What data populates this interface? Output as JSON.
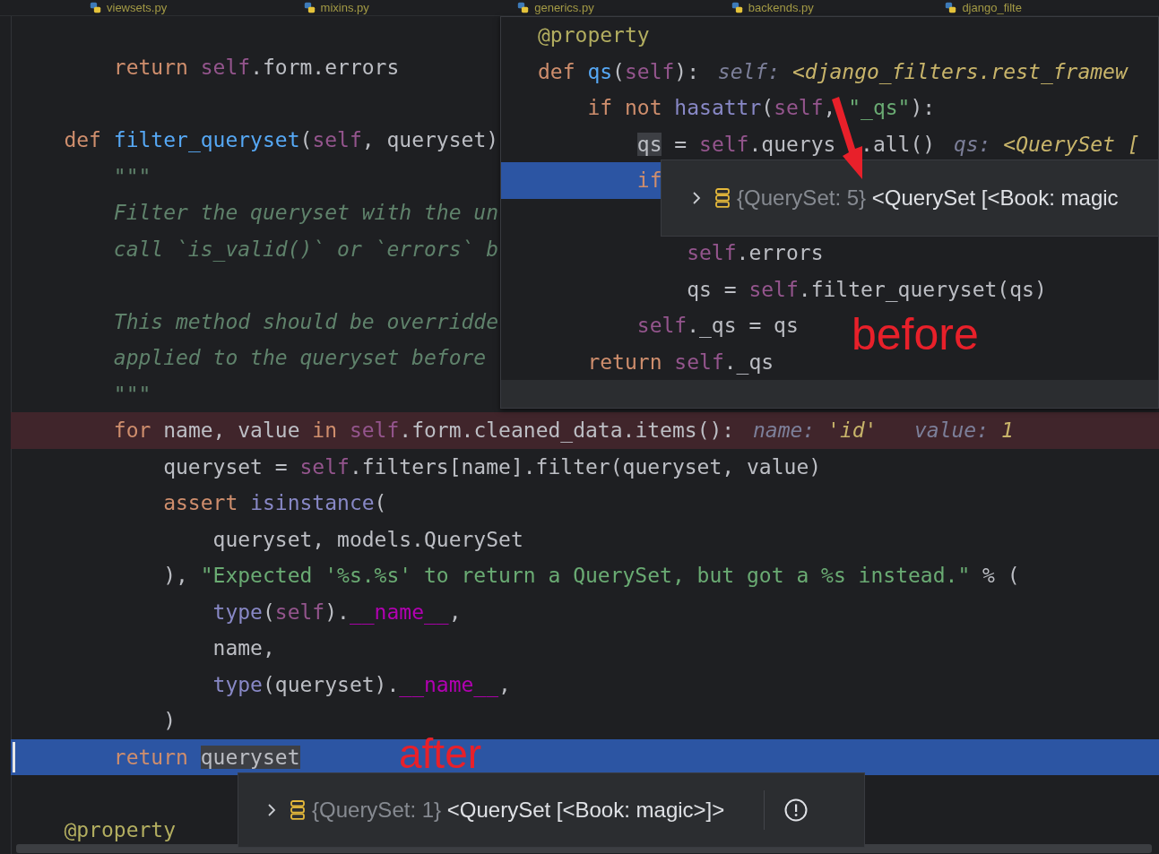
{
  "tabs": [
    {
      "label": "viewsets.py"
    },
    {
      "label": "mixins.py"
    },
    {
      "label": "generics.py"
    },
    {
      "label": "backends.py"
    },
    {
      "label": "django_filte"
    }
  ],
  "editor": {
    "lines": [
      {
        "kind": "normal",
        "tokens": [
          {
            "text": "        return",
            "kind": "kw"
          },
          {
            "text": " self",
            "kind": "self"
          },
          {
            "text": ".form.errors",
            "kind": "plain"
          }
        ]
      },
      {
        "kind": "blank"
      },
      {
        "kind": "normal",
        "tokens": [
          {
            "text": "    def",
            "kind": "kw"
          },
          {
            "text": " filter_queryset",
            "kind": "fn"
          },
          {
            "text": "(",
            "kind": "plain"
          },
          {
            "text": "self",
            "kind": "self"
          },
          {
            "text": ", queryset)",
            "kind": "plain"
          }
        ]
      },
      {
        "kind": "normal",
        "tokens": [
          {
            "text": "        \"\"\"",
            "kind": "doc"
          }
        ]
      },
      {
        "kind": "normal",
        "tokens": [
          {
            "text": "        Filter the queryset with the un",
            "kind": "doc"
          }
        ]
      },
      {
        "kind": "normal",
        "tokens": [
          {
            "text": "        call `is_valid()` or `errors` b",
            "kind": "doc"
          }
        ]
      },
      {
        "kind": "blank"
      },
      {
        "kind": "normal",
        "tokens": [
          {
            "text": "        This method should be overridde",
            "kind": "doc"
          }
        ]
      },
      {
        "kind": "normal",
        "tokens": [
          {
            "text": "        applied to the queryset before",
            "kind": "doc"
          }
        ]
      },
      {
        "kind": "normal",
        "tokens": [
          {
            "text": "        \"\"\"",
            "kind": "doc"
          }
        ]
      },
      {
        "kind": "breakpoint",
        "tokens": [
          {
            "text": "        for",
            "kind": "kw"
          },
          {
            "text": " name, value ",
            "kind": "plain"
          },
          {
            "text": "in",
            "kind": "kw"
          },
          {
            "text": " self",
            "kind": "self"
          },
          {
            "text": ".form.cleaned_data.items():",
            "kind": "plain"
          }
        ],
        "hints": [
          {
            "key": "name:",
            "value": "'id'"
          },
          {
            "key": "value:",
            "value": "1"
          }
        ]
      },
      {
        "kind": "normal",
        "tokens": [
          {
            "text": "            queryset = ",
            "kind": "plain"
          },
          {
            "text": "self",
            "kind": "self"
          },
          {
            "text": ".filters[name].filter(queryset, value)",
            "kind": "plain"
          }
        ]
      },
      {
        "kind": "normal",
        "tokens": [
          {
            "text": "            assert",
            "kind": "kw"
          },
          {
            "text": " isinstance",
            "kind": "builtin"
          },
          {
            "text": "(",
            "kind": "plain"
          }
        ]
      },
      {
        "kind": "normal",
        "tokens": [
          {
            "text": "                queryset, models.QuerySet",
            "kind": "plain"
          }
        ]
      },
      {
        "kind": "normal",
        "tokens": [
          {
            "text": "            ), ",
            "kind": "plain"
          },
          {
            "text": "\"Expected '%s.%s' to return a QuerySet, but got a %s instead.\"",
            "kind": "str"
          },
          {
            "text": " % (",
            "kind": "plain"
          }
        ]
      },
      {
        "kind": "normal",
        "tokens": [
          {
            "text": "                type",
            "kind": "builtin"
          },
          {
            "text": "(",
            "kind": "plain"
          },
          {
            "text": "self",
            "kind": "self"
          },
          {
            "text": ").",
            "kind": "plain"
          },
          {
            "text": "__name__",
            "kind": "dunder"
          },
          {
            "text": ",",
            "kind": "plain"
          }
        ]
      },
      {
        "kind": "normal",
        "tokens": [
          {
            "text": "                name,",
            "kind": "plain"
          }
        ]
      },
      {
        "kind": "normal",
        "tokens": [
          {
            "text": "                type",
            "kind": "builtin"
          },
          {
            "text": "(queryset).",
            "kind": "plain"
          },
          {
            "text": "__name__",
            "kind": "dunder"
          },
          {
            "text": ",",
            "kind": "plain"
          }
        ]
      },
      {
        "kind": "normal",
        "tokens": [
          {
            "text": "            )",
            "kind": "plain"
          }
        ]
      },
      {
        "kind": "current",
        "tokens": [
          {
            "text": "        return",
            "kind": "kw"
          },
          {
            "text": " queryset",
            "kind": "mark"
          }
        ]
      },
      {
        "kind": "blank"
      },
      {
        "kind": "normal",
        "tokens": [
          {
            "text": "    @property",
            "kind": "deco"
          }
        ]
      }
    ],
    "tooltip": {
      "type_label": "{QuerySet: 1}",
      "value": "<QuerySet [<Book: magic>]>"
    }
  },
  "popup": {
    "lines": [
      {
        "kind": "normal",
        "tokens": [
          {
            "text": "@property",
            "kind": "deco"
          }
        ]
      },
      {
        "kind": "normal",
        "tokens": [
          {
            "text": "def",
            "kind": "kw"
          },
          {
            "text": " qs",
            "kind": "fn"
          },
          {
            "text": "(",
            "kind": "plain"
          },
          {
            "text": "self",
            "kind": "self"
          },
          {
            "text": "):",
            "kind": "plain"
          }
        ],
        "hints": [
          {
            "key": "self:",
            "value": "<django_filters.rest_framew"
          }
        ]
      },
      {
        "kind": "normal",
        "tokens": [
          {
            "text": "    if not",
            "kind": "kw"
          },
          {
            "text": " hasattr",
            "kind": "builtin"
          },
          {
            "text": "(",
            "kind": "plain"
          },
          {
            "text": "self",
            "kind": "self"
          },
          {
            "text": ", ",
            "kind": "plain"
          },
          {
            "text": "\"_qs\"",
            "kind": "str"
          },
          {
            "text": "):",
            "kind": "plain"
          }
        ]
      },
      {
        "kind": "normal",
        "tokens": [
          {
            "text": "        qs",
            "kind": "mark"
          },
          {
            "text": " = ",
            "kind": "plain"
          },
          {
            "text": "self",
            "kind": "self"
          },
          {
            "text": ".querys",
            "kind": "plain"
          },
          {
            "text": ".all()",
            "kind": "plain",
            "after_cover": true
          }
        ],
        "hints": [
          {
            "key": "qs:",
            "value": "<QuerySet ["
          }
        ]
      },
      {
        "kind": "current",
        "tokens": [
          {
            "text": "        if",
            "kind": "kw"
          }
        ]
      },
      {
        "kind": "blank"
      },
      {
        "kind": "normal",
        "tokens": [
          {
            "text": "            self",
            "kind": "self"
          },
          {
            "text": ".errors",
            "kind": "plain"
          }
        ]
      },
      {
        "kind": "normal",
        "tokens": [
          {
            "text": "            qs = ",
            "kind": "plain"
          },
          {
            "text": "self",
            "kind": "self"
          },
          {
            "text": ".filter_queryset(qs)",
            "kind": "plain"
          }
        ]
      },
      {
        "kind": "normal",
        "tokens": [
          {
            "text": "        self",
            "kind": "self"
          },
          {
            "text": "._qs = qs",
            "kind": "plain"
          }
        ]
      },
      {
        "kind": "normal",
        "tokens": [
          {
            "text": "    return",
            "kind": "kw"
          },
          {
            "text": " self",
            "kind": "self"
          },
          {
            "text": "._qs",
            "kind": "plain"
          }
        ]
      }
    ],
    "tooltip": {
      "type_label": "{QuerySet: 5}",
      "value": "<QuerySet [<Book: magic"
    }
  },
  "annotations": [
    {
      "text": "before",
      "kind": "before"
    },
    {
      "text": "after",
      "kind": "after"
    }
  ]
}
